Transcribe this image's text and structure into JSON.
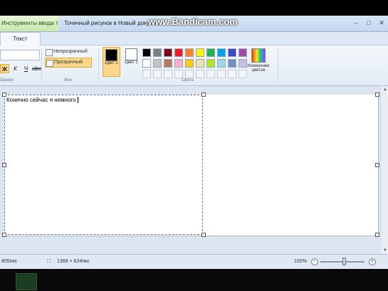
{
  "window": {
    "context_tab": "Инструменты ввода текста",
    "title": "Точечный рисунок в Новый документ",
    "watermark": "www.Bandicam.com"
  },
  "tabs": {
    "text_tab": "Текст"
  },
  "ribbon": {
    "font_group_label": "Шрифт",
    "format": {
      "bold": "Ж",
      "italic": "К",
      "underline": "Ч",
      "strike": "abc"
    },
    "background": {
      "group_label": "Фон",
      "opaque": "Непрозрачный",
      "transparent": "Прозрачный",
      "selected": "Прозрачный"
    },
    "colors": {
      "group_label": "Цвета",
      "color1_label": "Цвет 1",
      "color2_label": "Цвет 2",
      "color1": "#000000",
      "color2": "#ffffff",
      "edit_label": "Изменение цветов",
      "palette_row1": [
        "#000000",
        "#7f7f7f",
        "#880015",
        "#ed1c24",
        "#ff7f27",
        "#fff200",
        "#22b14c",
        "#00a2e8",
        "#3f48cc",
        "#a349a4"
      ],
      "palette_row2": [
        "#ffffff",
        "#c3c3c3",
        "#b97a57",
        "#ffaec9",
        "#ffc90e",
        "#efe4b0",
        "#b5e61d",
        "#99d9ea",
        "#7092be",
        "#c8bfe7"
      ]
    }
  },
  "canvas": {
    "typed_text": "Конечно сейчас я немного"
  },
  "status": {
    "left_text": "805пкс",
    "canvas_size": "1368 × 624пкс",
    "zoom": "100%",
    "zoom_minus": "−",
    "zoom_plus": "+"
  }
}
